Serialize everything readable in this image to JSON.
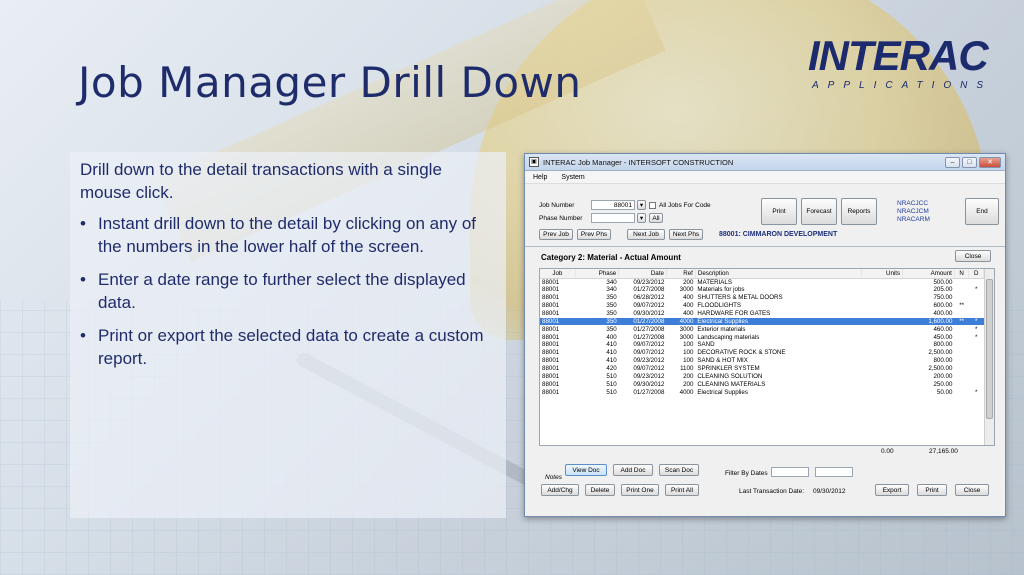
{
  "slide": {
    "title": "Job Manager Drill Down",
    "intro": "Drill down to the detail transactions with a single mouse click.",
    "bullets": [
      "Instant drill down to the detail by clicking on any of the numbers in the lower half of the screen.",
      "Enter a date range to further select the displayed data.",
      "Print or export the selected data to create a custom report."
    ]
  },
  "logo": {
    "main": "INTERAC",
    "sub": "APPLICATIONS"
  },
  "window": {
    "title": "INTERAC Job Manager - INTERSOFT CONSTRUCTION",
    "menu": [
      "Help",
      "System"
    ],
    "job_number_label": "Job Number",
    "job_number_value": "88001",
    "phase_number_label": "Phase Number",
    "phase_number_value": "",
    "all_jobs_label": "All Jobs For Code",
    "all_label": "All",
    "buttons": {
      "prev_job": "Prev Job",
      "prev_phs": "Prev Phs",
      "next_job": "Next Job",
      "next_phs": "Next Phs",
      "print": "Print",
      "forecast": "Forecast",
      "reports": "Reports",
      "end": "End"
    },
    "links": [
      "NRACJCC",
      "NRACJCM",
      "NRACARM"
    ],
    "job_name": "88001: CIMMARON DEVELOPMENT",
    "category": "Category  2: Material - Actual Amount",
    "close_label": "Close",
    "columns": [
      "Job",
      "Phase",
      "Date",
      "Ref",
      "Description",
      "Units",
      "Amount",
      "N",
      "D"
    ],
    "rows": [
      [
        "88001",
        "340",
        "09/23/2012",
        "200",
        "MATERIALS",
        "",
        "500.00",
        "",
        ""
      ],
      [
        "88001",
        "340",
        "01/27/2008",
        "3000",
        "Materials for jobs",
        "",
        "205.00",
        "",
        "*"
      ],
      [
        "88001",
        "350",
        "06/28/2012",
        "400",
        "SHUTTERS & METAL DOORS",
        "",
        "750.00",
        "",
        ""
      ],
      [
        "88001",
        "350",
        "09/07/2012",
        "400",
        "FLOODLIGHTS",
        "",
        "600.00",
        "**",
        ""
      ],
      [
        "88001",
        "350",
        "09/30/2012",
        "400",
        "HARDWARE FOR GATES",
        "",
        "400.00",
        "",
        ""
      ],
      [
        "88001",
        "350",
        "01/27/2008",
        "4000",
        "Electrical Supplies",
        "",
        "1,600.00",
        "**",
        "*"
      ],
      [
        "88001",
        "350",
        "01/27/2008",
        "3000",
        "Exterior materials",
        "",
        "460.00",
        "",
        "*"
      ],
      [
        "88001",
        "400",
        "01/27/2008",
        "3000",
        "Landscaping materials",
        "",
        "450.00",
        "",
        "*"
      ],
      [
        "88001",
        "410",
        "09/07/2012",
        "100",
        "SAND",
        "",
        "800.00",
        "",
        ""
      ],
      [
        "88001",
        "410",
        "09/07/2012",
        "100",
        "DECORATIVE ROCK & STONE",
        "",
        "2,500.00",
        "",
        ""
      ],
      [
        "88001",
        "410",
        "09/23/2012",
        "100",
        "SAND & HOT MIX",
        "",
        "800.00",
        "",
        ""
      ],
      [
        "88001",
        "420",
        "09/07/2012",
        "1100",
        "SPRINKLER SYSTEM",
        "",
        "2,500.00",
        "",
        ""
      ],
      [
        "88001",
        "510",
        "09/23/2012",
        "200",
        "CLEANING SOLUTION",
        "",
        "200.00",
        "",
        ""
      ],
      [
        "88001",
        "510",
        "09/30/2012",
        "200",
        "CLEANING MATERIALS",
        "",
        "250.00",
        "",
        ""
      ],
      [
        "88001",
        "510",
        "01/27/2008",
        "4000",
        "Electrical Supplies",
        "",
        "50.00",
        "",
        "*"
      ]
    ],
    "selected_row": 5,
    "total_units": "0.00",
    "total_amount": "27,165.00",
    "notes_label": "Notes",
    "doc_buttons": [
      "View Doc",
      "Add Doc",
      "Scan Doc"
    ],
    "note_buttons": [
      "Add/Chg",
      "Delete",
      "Print One",
      "Print All"
    ],
    "filter_label": "Filter By Dates",
    "last_trans_label": "Last Transaction Date:",
    "last_trans_value": "09/30/2012",
    "footer_buttons": [
      "Export",
      "Print",
      "Close"
    ]
  }
}
